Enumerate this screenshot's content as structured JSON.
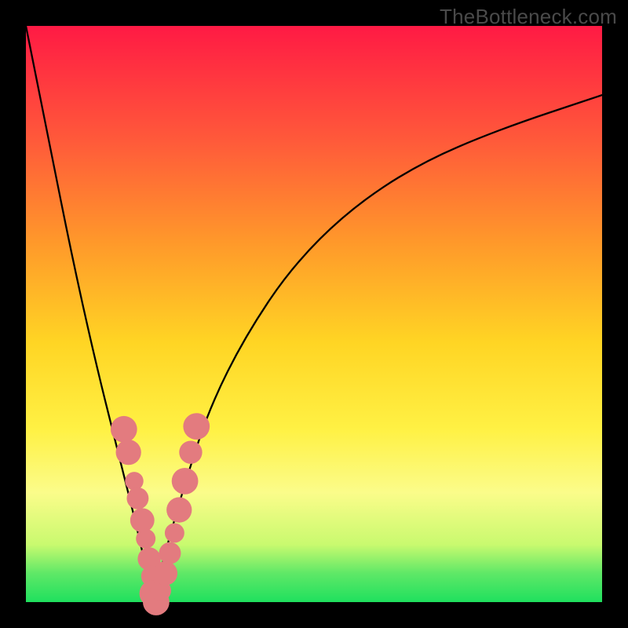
{
  "watermark": "TheBottleneck.com",
  "chart_data": {
    "type": "line",
    "title": "",
    "xlabel": "",
    "ylabel": "",
    "xlim": [
      0,
      100
    ],
    "ylim": [
      0,
      100
    ],
    "x_min_point": 22,
    "series": [
      {
        "name": "bottleneck-curve",
        "x": [
          0,
          4,
          8,
          12,
          16,
          20,
          22,
          24,
          28,
          32,
          38,
          46,
          56,
          68,
          82,
          100
        ],
        "y": [
          100,
          80,
          60,
          42,
          26,
          10,
          0,
          8,
          22,
          34,
          46,
          58,
          68,
          76,
          82,
          88
        ]
      }
    ],
    "markers": {
      "name": "highlight-dots",
      "color": "#e37b7f",
      "points": [
        {
          "x": 17.0,
          "y": 30.0,
          "r": 2.3
        },
        {
          "x": 17.8,
          "y": 26.0,
          "r": 2.2
        },
        {
          "x": 18.8,
          "y": 21.0,
          "r": 1.6
        },
        {
          "x": 19.4,
          "y": 18.0,
          "r": 1.9
        },
        {
          "x": 20.2,
          "y": 14.2,
          "r": 2.1
        },
        {
          "x": 20.8,
          "y": 11.0,
          "r": 1.7
        },
        {
          "x": 21.4,
          "y": 7.5,
          "r": 2.0
        },
        {
          "x": 21.8,
          "y": 4.5,
          "r": 1.8
        },
        {
          "x": 22.0,
          "y": 1.5,
          "r": 2.3
        },
        {
          "x": 22.6,
          "y": 0.0,
          "r": 2.3
        },
        {
          "x": 23.4,
          "y": 2.0,
          "r": 1.8
        },
        {
          "x": 24.2,
          "y": 5.0,
          "r": 2.1
        },
        {
          "x": 25.0,
          "y": 8.5,
          "r": 1.9
        },
        {
          "x": 25.8,
          "y": 12.0,
          "r": 1.7
        },
        {
          "x": 26.6,
          "y": 16.0,
          "r": 2.2
        },
        {
          "x": 27.6,
          "y": 21.0,
          "r": 2.3
        },
        {
          "x": 28.6,
          "y": 26.0,
          "r": 2.0
        },
        {
          "x": 29.6,
          "y": 30.5,
          "r": 2.3
        }
      ]
    }
  }
}
